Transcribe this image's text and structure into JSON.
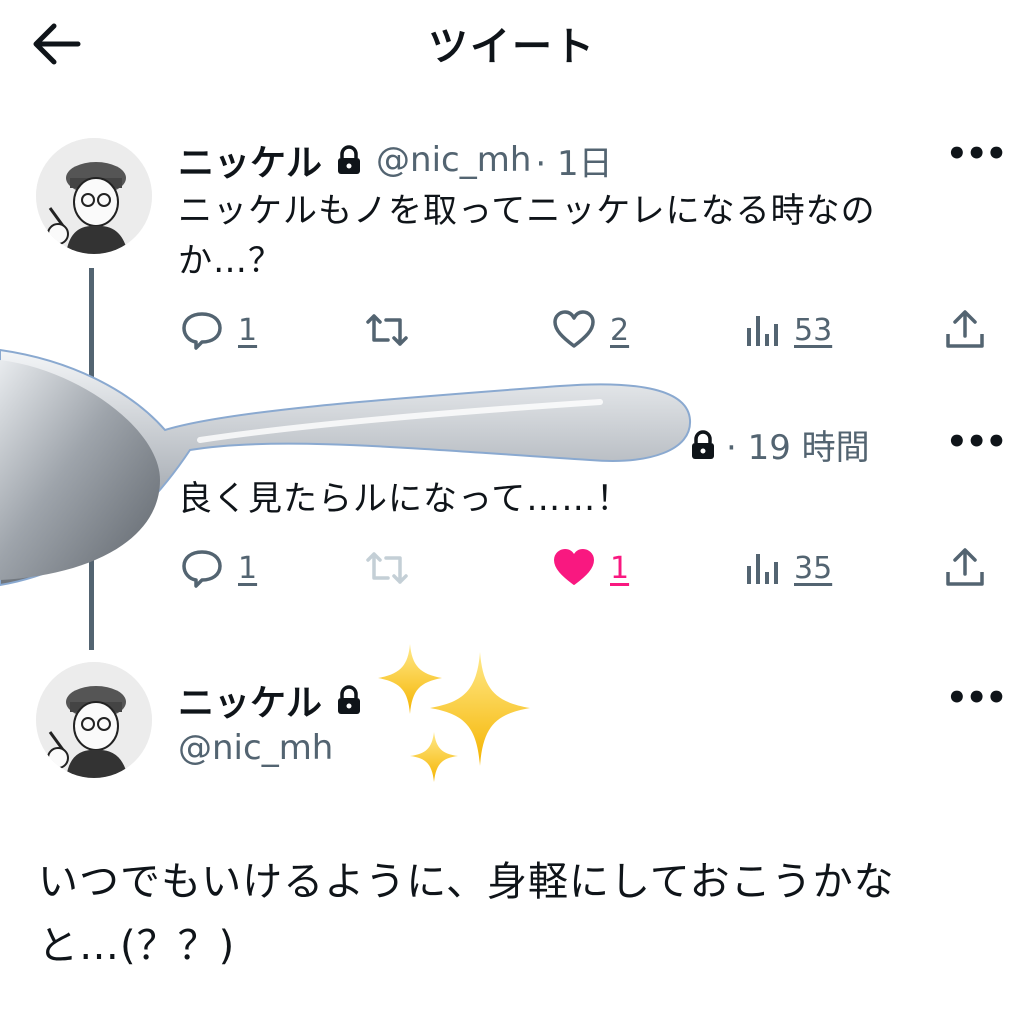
{
  "header": {
    "title": "ツイート"
  },
  "tweet1": {
    "name": "ニッケル",
    "handle": "@nic_mh",
    "time": "· 1日",
    "text_line1": "ニッケルもノを取ってニッケレになる時なの",
    "text_line2": "か…？",
    "replies": "1",
    "likes": "2",
    "views": "53"
  },
  "tweet2": {
    "time": "· 19 時間",
    "text": "良く見たらルになって……！",
    "replies": "1",
    "likes": "1",
    "views": "35"
  },
  "main_tweet": {
    "name": "ニッケル",
    "handle": "@nic_mh",
    "text_line1": "いつでもいけるように、身軽にしておこうかな",
    "text_line2": "と…(？？)"
  },
  "colors": {
    "text": "#0f1419",
    "secondary": "#536471",
    "like_active": "#f91880"
  },
  "icons": [
    "back-arrow-icon",
    "lock-icon",
    "more-icon",
    "reply-icon",
    "retweet-icon",
    "like-icon",
    "views-icon",
    "share-icon",
    "sparkles-icon"
  ]
}
